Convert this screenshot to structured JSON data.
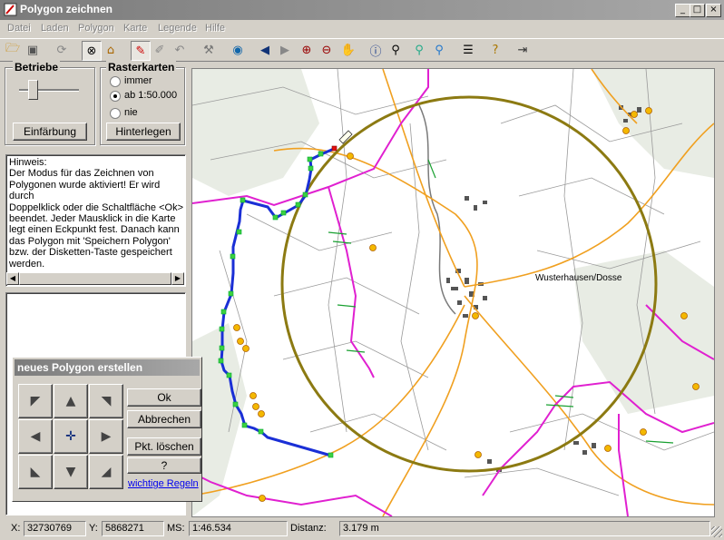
{
  "window": {
    "title": "Polygon zeichnen"
  },
  "menu": [
    "Datei",
    "Laden",
    "Polygon",
    "Karte",
    "Legende",
    "Hilfe"
  ],
  "betriebe": {
    "title": "Betriebe",
    "button": "Einfärbung"
  },
  "rasterkarten": {
    "title": "Rasterkarten",
    "options": [
      "immer",
      "ab 1:50.000",
      "nie"
    ],
    "selected": "ab 1:50.000",
    "button": "Hinterlegen"
  },
  "hinweis": {
    "lines": [
      "Hinweis:",
      "Der Modus für das Zeichnen von",
      "Polygonen wurde aktiviert! Er wird durch",
      "Doppelklick oder die Schaltfläche <Ok>",
      "beendet. Jeder Mausklick in die Karte",
      "legt einen Eckpunkt fest. Danach kann",
      "das Polygon mit 'Speichern Polygon'",
      "bzw. der Disketten-Taste gespeichert",
      "werden."
    ]
  },
  "polygon_dialog": {
    "title": "neues Polygon erstellen",
    "ok": "Ok",
    "cancel": "Abbrechen",
    "delete_point": "Pkt. löschen",
    "help": "?",
    "rules_link": "wichtige Regeln"
  },
  "map": {
    "place_label": "Wusterhausen/Dosse"
  },
  "status": {
    "x_label": "X:",
    "x_value": "32730769",
    "y_label": "Y:",
    "y_value": "5868271",
    "ms_label": "MS:",
    "ms_value": "1:46.534",
    "dist_label": "Distanz:",
    "dist_value": "3.179 m"
  },
  "colors": {
    "polygon": "#1a2fd6",
    "circle": "#8c7a12",
    "boundary": "#e020d0",
    "road": "#f0a020"
  }
}
